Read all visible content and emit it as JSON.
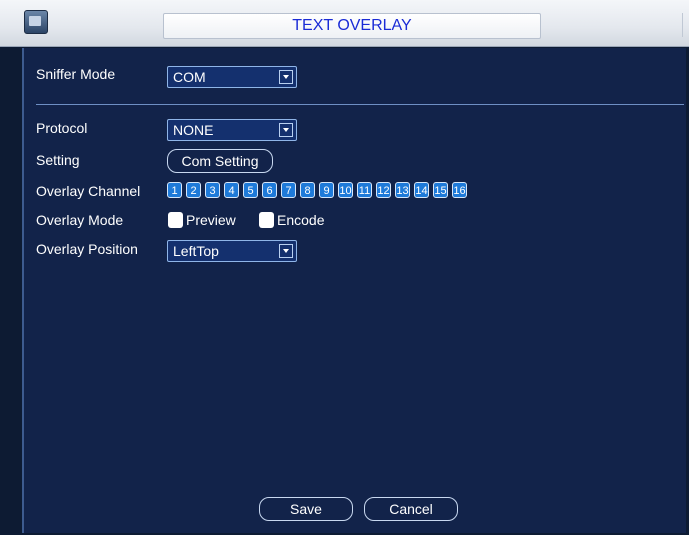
{
  "window": {
    "title": "TEXT OVERLAY"
  },
  "form": {
    "sniffer_mode": {
      "label": "Sniffer Mode",
      "value": "COM"
    },
    "protocol": {
      "label": "Protocol",
      "value": "NONE"
    },
    "setting": {
      "label": "Setting",
      "button": "Com Setting"
    },
    "overlay_channel": {
      "label": "Overlay Channel",
      "channels": [
        "1",
        "2",
        "3",
        "4",
        "5",
        "6",
        "7",
        "8",
        "9",
        "10",
        "11",
        "12",
        "13",
        "14",
        "15",
        "16"
      ]
    },
    "overlay_mode": {
      "label": "Overlay Mode",
      "preview": "Preview",
      "encode": "Encode"
    },
    "overlay_position": {
      "label": "Overlay Position",
      "value": "LeftTop"
    }
  },
  "footer": {
    "save": "Save",
    "cancel": "Cancel"
  },
  "colors": {
    "accent": "#1e7ad9",
    "title_text": "#1a2bd6",
    "panel_bg": "#12234a"
  }
}
